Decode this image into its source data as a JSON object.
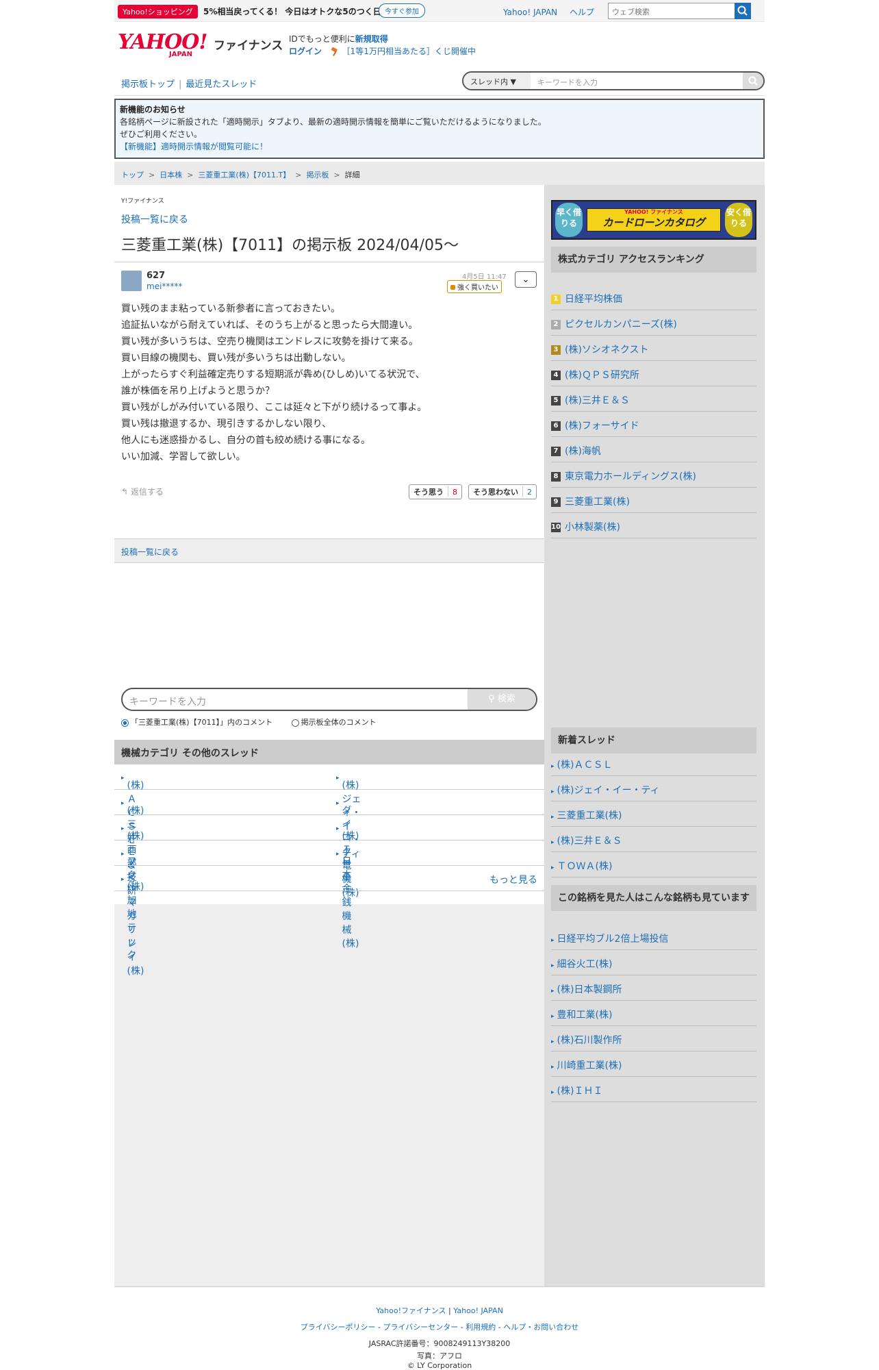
{
  "promo": {
    "badge": "Yahoo!ショッピング",
    "text": "5%相当戻ってくる！ 今日はオトクな5のつく日",
    "button": "今すぐ参加"
  },
  "top_links": {
    "yahoo_japan": "Yahoo! JAPAN",
    "help": "ヘルプ",
    "web_search_placeholder": "ウェブ検索"
  },
  "header": {
    "logo": "YAHOO!",
    "logo_sub": "JAPAN",
    "service": "ファイナンス",
    "id_text": "IDでもっと便利に",
    "signup": "新規取得",
    "login": "ログイン",
    "lottery": "［1等1万円相当あたる］くじ開催中"
  },
  "subnav": {
    "board_top": "掲示板トップ",
    "recent": "最近見たスレッド",
    "scope": "スレッド内",
    "search_placeholder": "キーワードを入力"
  },
  "notice": {
    "title": "新機能のお知らせ",
    "line1": "各銘柄ページに新設された「適時開示」タブより、最新の適時開示情報を簡単にご覧いただけるようになりました。",
    "line2": "ぜひご利用ください。",
    "link": "【新機能】適時開示情報が閲覧可能に！"
  },
  "breadcrumb": [
    "トップ",
    "日本株",
    "三菱重工業(株)【7011.T】",
    "掲示板",
    "詳細"
  ],
  "main": {
    "yf_small": "Y!ファイナンス",
    "back_link": "投稿一覧に戻る",
    "title": "三菱重工業(株)【7011】の掲示板 2024/04/05〜",
    "post": {
      "number": "627",
      "user": "mei*****",
      "date": "4月5日 11:47",
      "sentiment": "強く買いたい",
      "body": [
        "買い残のまま粘っている新参者に言っておきたい。",
        "追証払いながら耐えていれば、そのうち上がると思ったら大間違い。",
        "買い残が多いうちは、空売り機関はエンドレスに攻勢を掛けて来る。",
        "買い目線の機関も、買い残が多いうちは出動しない。",
        "上がったらすぐ利益確定売りする短期派が犇め(ひしめ)いてる状況で、",
        "誰が株価を吊り上げようと思うか？",
        "買い残がしがみ付いている限り、ここは延々と下がり続けるって事よ。",
        "買い残は撤退するか、現引きするかしない限り、",
        "他人にも迷惑掛かるし、自分の首も絞め続ける事になる。",
        "いい加減、学習して欲しい。"
      ],
      "reply": "返信する",
      "agree_label": "そう思う",
      "agree_count": "8",
      "disagree_label": "そう思わない",
      "disagree_count": "2"
    },
    "back_bar": "投稿一覧に戻る",
    "keyword_placeholder": "キーワードを入力",
    "keyword_button": "検索",
    "radio_thread": "「三菱重工業(株)【7011】」内のコメント",
    "radio_all": "掲示板全体のコメント",
    "category_title": "機械カテゴリ その他のスレッド",
    "category_items": [
      [
        "(株)ＡＣＳＬ",
        "(株)ジェイ・イー・ティ"
      ],
      [
        "(株)三井Ｅ＆Ｓ",
        "ダイコク電機(株)"
      ],
      [
        "(株)西部技研",
        "(株)ＩＨＩ"
      ],
      [
        "フクシマガリレイ(株)",
        "日本金銭機械(株)"
      ]
    ],
    "category_last": "(株)加地テック",
    "more": "もっと見る"
  },
  "side": {
    "ad": {
      "left": "早く借りる",
      "brand": "YAHOO! ファイナンス",
      "title": "カードローンカタログ",
      "right": "安く借りる"
    },
    "ranking_title": "株式カテゴリ アクセスランキング",
    "ranking": [
      "日経平均株価",
      "ピクセルカンパニーズ(株)",
      "(株)ソシオネクスト",
      "(株)ＱＰＳ研究所",
      "(株)三井Ｅ＆Ｓ",
      "(株)フォーサイド",
      "(株)海帆",
      "東京電力ホールディングス(株)",
      "三菱重工業(株)",
      "小林製薬(株)"
    ],
    "new_title": "新着スレッド",
    "new_threads": [
      "(株)ＡＣＳＬ",
      "(株)ジェイ・イー・ティ",
      "三菱重工業(株)",
      "(株)三井Ｅ＆Ｓ",
      "ＴＯＷＡ(株)"
    ],
    "also_title": "この銘柄を見た人はこんな銘柄も見ています",
    "also_viewed": [
      "日経平均ブル2倍上場投信",
      "細谷火工(株)",
      "(株)日本製鋼所",
      "豊和工業(株)",
      "(株)石川製作所",
      "川崎重工業(株)",
      "(株)ＩＨＩ"
    ]
  },
  "footer": {
    "yf": "Yahoo!ファイナンス",
    "yj": "Yahoo! JAPAN",
    "privacy_policy": "プライバシーポリシー",
    "privacy_center": "プライバシーセンター",
    "terms": "利用規約",
    "help": "ヘルプ・お問い合わせ",
    "jasrac": "JASRAC許諾番号：9008249113Y38200",
    "photo": "写真：アフロ",
    "copyright": "© LY Corporation"
  }
}
